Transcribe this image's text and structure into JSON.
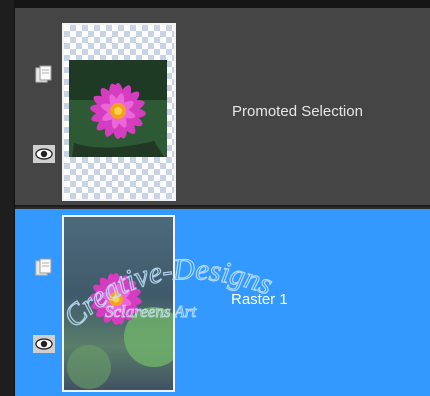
{
  "layers": [
    {
      "name": "Promoted Selection",
      "selected": false,
      "icons": [
        "page-icon",
        "eye-icon"
      ]
    },
    {
      "name": "Raster 1",
      "selected": true,
      "icons": [
        "page-icon",
        "eye-icon"
      ]
    }
  ],
  "watermark": {
    "line1": "Creative-Designs",
    "line2": "Sclareens Art"
  },
  "colors": {
    "panel_bg": "#454545",
    "selected_bg": "#3399ff",
    "border": "#1d1d1d"
  }
}
